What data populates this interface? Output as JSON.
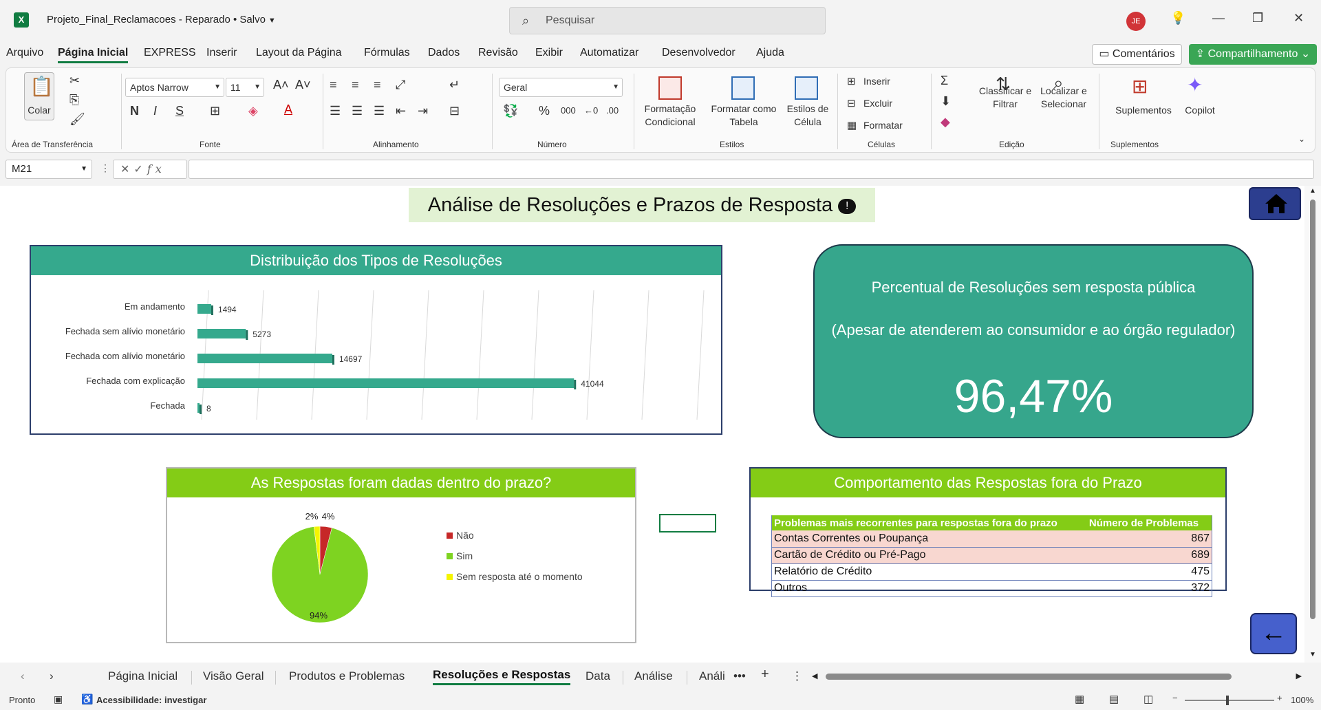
{
  "window": {
    "doc_title": "Projeto_Final_Reclamacoes  -  Reparado • Salvo",
    "search_placeholder": "Pesquisar",
    "user_initials": "JE"
  },
  "menu": {
    "items": [
      "Arquivo",
      "Página Inicial",
      "EXPRESS",
      "Inserir",
      "Layout da Página",
      "Fórmulas",
      "Dados",
      "Revisão",
      "Exibir",
      "Automatizar",
      "Desenvolvedor",
      "Ajuda"
    ],
    "active": "Página Inicial",
    "comments": "Comentários",
    "share": "Compartilhamento"
  },
  "ribbon": {
    "paste": "Colar",
    "clipboard_group": "Área de Transferência",
    "font_name": "Aptos Narrow",
    "font_size": "11",
    "font_group": "Fonte",
    "bold": "N",
    "italic": "I",
    "underline": "S",
    "alignment_group": "Alinhamento",
    "number_format": "Geral",
    "number_group": "Número",
    "cond_format": "Formatação Condicional",
    "format_table": "Formatar como Tabela",
    "cell_styles": "Estilos de Célula",
    "styles_group": "Estilos",
    "insert": "Inserir",
    "delete": "Excluir",
    "format": "Formatar",
    "cells_group": "Células",
    "sort_filter": "Classificar e Filtrar",
    "find_select": "Localizar e Selecionar",
    "editing_group": "Edição",
    "addins": "Suplementos",
    "addins_group": "Suplementos",
    "copilot": "Copilot"
  },
  "formula_bar": {
    "cell_ref": "M21",
    "formula": ""
  },
  "sheet": {
    "title": "Análise de Resoluções e Prazos de Resposta",
    "bar_panel_title": "Distribuição dos Tipos de Resoluções",
    "kpi": {
      "line1": "Percentual de Resoluções sem resposta pública",
      "line2": "(Apesar de atenderem ao consumidor e ao órgão regulador)",
      "value": "96,47%"
    },
    "pie_panel_title": "As Respostas foram dadas dentro do prazo?",
    "table_panel_title": "Comportamento das Respostas fora do Prazo",
    "table": {
      "headers": [
        "Problemas mais recorrentes para respostas fora do prazo",
        "Número de Problemas"
      ],
      "rows": [
        [
          "Contas Correntes ou Poupança",
          "867"
        ],
        [
          "Cartão de Crédito ou Pré-Pago",
          "689"
        ],
        [
          "Relatório de Crédito",
          "475"
        ],
        [
          "Outros",
          "372"
        ]
      ]
    }
  },
  "chart_data": [
    {
      "type": "bar",
      "orientation": "horizontal",
      "title": "Distribuição dos Tipos de Resoluções",
      "categories": [
        "Em andamento",
        "Fechada sem alívio monetário",
        "Fechada com alívio monetário",
        "Fechada com explicação",
        "Fechada"
      ],
      "values": [
        1494,
        5273,
        14697,
        41044,
        8
      ],
      "data_labels": [
        "1494",
        "5273",
        "14697",
        "41044",
        "8"
      ],
      "color": "#35a98d",
      "grid": true
    },
    {
      "type": "pie",
      "title": "As Respostas foram dadas dentro do prazo?",
      "categories": [
        "Não",
        "Sim",
        "Sem resposta até o momento"
      ],
      "values": [
        4,
        94,
        2
      ],
      "data_labels": [
        "4%",
        "94%",
        "2%"
      ],
      "colors": [
        "#c62828",
        "#7ed321",
        "#f5f500"
      ],
      "legend": "right"
    }
  ],
  "tabs": {
    "items": [
      "Página Inicial",
      "Visão Geral",
      "Produtos e Problemas",
      "Resoluções e Respostas",
      "Data",
      "Análise",
      "Análi"
    ],
    "active": "Resoluções e Respostas"
  },
  "status": {
    "ready": "Pronto",
    "accessibility": "Acessibilidade: investigar",
    "zoom": "100%"
  }
}
